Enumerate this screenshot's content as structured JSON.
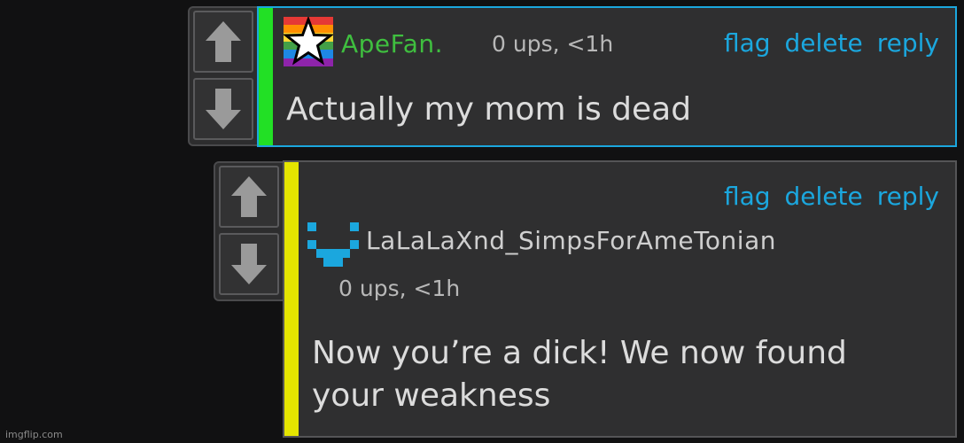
{
  "comments": [
    {
      "username": "ApeFan.",
      "meta": "0 ups, <1h",
      "actions": {
        "flag": "flag",
        "delete": "delete",
        "reply": "reply"
      },
      "text": "Actually my mom is dead",
      "stripe_color": "#22e025",
      "username_color": "#3fbf3f",
      "avatar_icon": "rainbow-star-icon"
    },
    {
      "username": "LaLaLaXnd_SimpsForAmeTonian",
      "meta": "0 ups, <1h",
      "actions": {
        "flag": "flag",
        "delete": "delete",
        "reply": "reply"
      },
      "text_line1": "Now you’re a dick! We now found",
      "text_line2": "your weakness",
      "stripe_color": "#e5e500",
      "username_color": "#cfcfcf",
      "avatar_icon": "pixel-smiley-icon"
    }
  ],
  "colors": {
    "link": "#1ba7de",
    "background": "#111112"
  },
  "watermark": "imgflip.com"
}
